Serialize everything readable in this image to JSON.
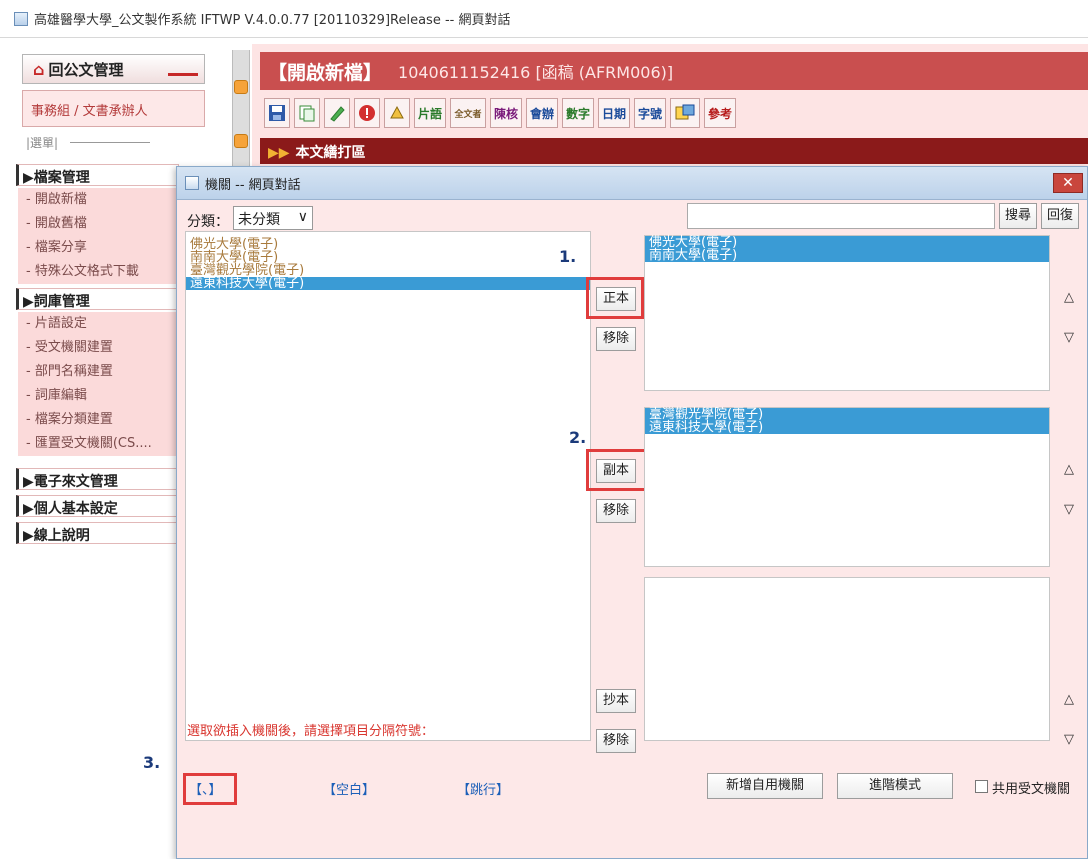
{
  "window": {
    "title": "高雄醫學大學_公文製作系統 IFTWP V.4.0.0.77 [20110329]Release -- 網頁對話"
  },
  "left": {
    "home_label": "回公文管理",
    "role": "事務組 / 文書承辦人",
    "menu_header": "|選單|",
    "sections": [
      {
        "label": "▶檔案管理",
        "items": [
          "- 開啟新檔",
          "- 開啟舊檔",
          "- 檔案分享",
          "- 特殊公文格式下載"
        ]
      },
      {
        "label": "▶詞庫管理",
        "items": [
          "- 片語設定",
          "- 受文機關建置",
          "- 部門名稱建置",
          "- 詞庫編輯",
          "- 檔案分類建置",
          "- 匯置受文機關(CS...."
        ]
      },
      {
        "label": "▶電子來文管理",
        "items": []
      },
      {
        "label": "▶個人基本設定",
        "items": []
      },
      {
        "label": "▶線上說明",
        "items": []
      }
    ]
  },
  "main": {
    "header_title": "【開啟新檔】",
    "doc_number": "1040611152416 [函稿 (AFRM006)]",
    "toolbar": [
      "片語",
      "全文者",
      "陳核",
      "會辦",
      "數字",
      "日期",
      "字號",
      "參考"
    ],
    "section_title": "本文繕打區"
  },
  "dialog": {
    "title": "機關 -- 網頁對話",
    "close": "✕",
    "category_label": "分類：",
    "category_value": "未分類",
    "search_button": "搜尋",
    "restore_button": "回復",
    "source_list": [
      "佛光大學(電子)",
      "南南大學(電子)",
      "臺灣觀光學院(電子)",
      "遠東科技大學(電子)"
    ],
    "zhengben": {
      "add": "正本",
      "remove": "移除",
      "items": [
        "佛光大學(電子)",
        "南南大學(電子)"
      ]
    },
    "fuben": {
      "add": "副本",
      "remove": "移除",
      "items": [
        "臺灣觀光學院(電子)",
        "遠東科技大學(電子)"
      ]
    },
    "chaoben": {
      "add": "抄本",
      "remove": "移除",
      "items": []
    },
    "up_arrow": "△",
    "down_arrow": "▽",
    "steps": [
      "1.",
      "2.",
      "3."
    ],
    "hint": "選取欲插入機關後，請選擇項目分隔符號：",
    "separators": [
      "【、】",
      "【空白】",
      "【跳行】"
    ],
    "add_custom_button": "新增自用機關",
    "advanced_button": "進階模式",
    "shared_label": "共用受文機關"
  },
  "colors": {
    "accent": "#c94f4f",
    "selection": "#3a9bd5",
    "highlight_box": "#e03c3c",
    "step_number": "#1b3a7a"
  }
}
